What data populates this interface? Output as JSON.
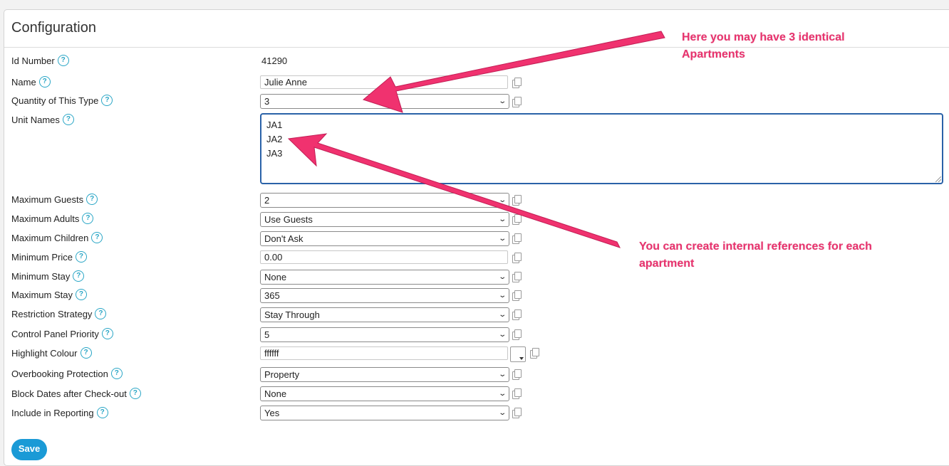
{
  "panel": {
    "title": "Configuration"
  },
  "fields": {
    "id_number": {
      "label": "Id Number",
      "value": "41290"
    },
    "name": {
      "label": "Name",
      "value": "Julie Anne"
    },
    "quantity": {
      "label": "Quantity of This Type",
      "value": "3"
    },
    "unit_names": {
      "label": "Unit Names",
      "lines": [
        "JA1",
        "JA2",
        "JA3"
      ]
    },
    "max_guests": {
      "label": "Maximum Guests",
      "value": "2"
    },
    "max_adults": {
      "label": "Maximum Adults",
      "value": "Use Guests"
    },
    "max_children": {
      "label": "Maximum Children",
      "value": "Don't Ask"
    },
    "min_price": {
      "label": "Minimum Price",
      "value": "0.00"
    },
    "min_stay": {
      "label": "Minimum Stay",
      "value": "None"
    },
    "max_stay": {
      "label": "Maximum Stay",
      "value": "365"
    },
    "restriction": {
      "label": "Restriction Strategy",
      "value": "Stay Through"
    },
    "priority": {
      "label": "Control Panel Priority",
      "value": "5"
    },
    "highlight": {
      "label": "Highlight Colour",
      "value": "ffffff"
    },
    "overbooking": {
      "label": "Overbooking Protection",
      "value": "Property"
    },
    "block_dates": {
      "label": "Block Dates after Check-out",
      "value": "None"
    },
    "reporting": {
      "label": "Include in Reporting",
      "value": "Yes"
    }
  },
  "help_glyph": "?",
  "save_label": "Save",
  "annotations": {
    "top_line1": "Here you may have 3 identical",
    "top_line2": "Apartments",
    "bottom_line1": "You can create internal references for each",
    "bottom_line2": "apartment"
  },
  "colors": {
    "accent": "#1a9ad6",
    "annotation": "#e8336e",
    "focus": "#2a62a8"
  }
}
